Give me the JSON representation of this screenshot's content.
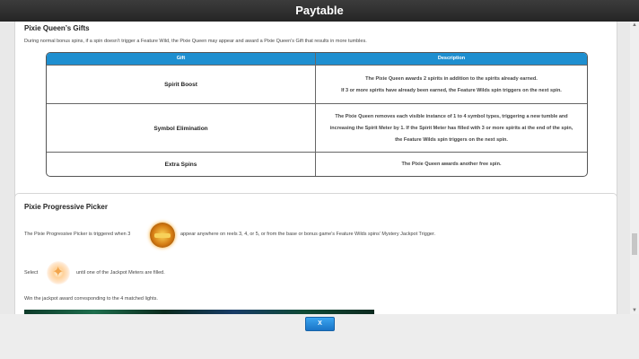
{
  "window": {
    "title": "Paytable"
  },
  "section1": {
    "title": "Pixie Queen’s Gifts",
    "intro": "During normal bonus spins, if a spin doesn’t trigger a Feature Wild, the Pixie Queen may appear and award a Pixie Queen’s Gift that results in more tumbles.",
    "table": {
      "headers": {
        "gift": "Gift",
        "description": "Description"
      },
      "rows": [
        {
          "gift": "Spirit Boost",
          "description": [
            "The Pixie Queen awards 2 spirits in addition to the spirits already earned.",
            "If 3 or more spirits have already been earned, the Feature Wilds spin triggers on the next spin."
          ]
        },
        {
          "gift": "Symbol Elimination",
          "description": [
            "The Pixie Queen removes each visible instance of 1 to 4 symbol types, triggering a new tumble and",
            "increasing the Spirit Meter by 1. If the Spirit Meter has filled with 3 or more spirits at the end of the spin,",
            "the Feature Wilds spin triggers on the next spin."
          ]
        },
        {
          "gift": "Extra Spins",
          "description": [
            "The Pixie Queen awards another free spin."
          ]
        }
      ]
    }
  },
  "section2": {
    "title": "Pixie Progressive Picker",
    "line1_before": "The Pixie Progressive Picker is triggered when 3",
    "line1_after": "appear anywhere on reels 3, 4, or 5, or from the base or bonus game’s Feature Wilds spins’ Mystery Jackpot Trigger.",
    "line2_before": "Select",
    "line2_after": "until one of the Jackpot Meters are filled.",
    "line3": "Win the jackpot award corresponding to the 4 matched lights."
  },
  "footer": {
    "close_label": "X"
  },
  "icons": {
    "jackpot_symbol": "jackpot-badge-icon",
    "pick_symbol": "sparkle-light-icon"
  },
  "colors": {
    "header_bg": "#1e8fd0",
    "titlebar_bg": "#2b2b2b",
    "button_bg": "#2a8de0"
  }
}
